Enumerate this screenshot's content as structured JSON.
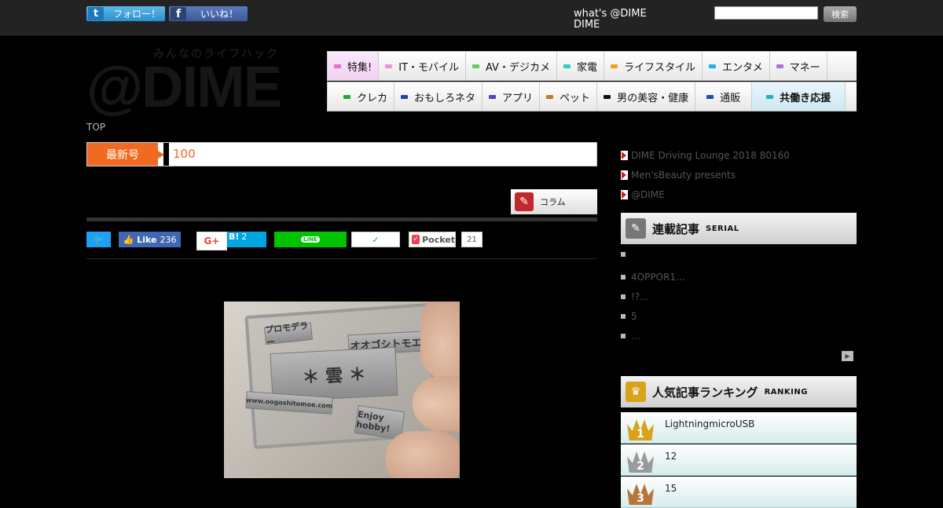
{
  "topbar": {
    "twitter_follow": "フォロー！",
    "twitter_icon": "t",
    "facebook_like": "いいね！",
    "facebook_icon": "f",
    "whats_line1": "what's @DIME",
    "whats_line2": "DIME",
    "search_placeholder": "",
    "search_button": "検索"
  },
  "logo": {
    "tagline": "みんなのライフハック",
    "mark": "@DIME"
  },
  "nav": {
    "row1": [
      {
        "label": "特集!",
        "color": "#e86bd8"
      },
      {
        "label": "IT・モバイル",
        "color": "#f090e0"
      },
      {
        "label": "AV・デジカメ",
        "color": "#5ad05a"
      },
      {
        "label": "家電",
        "color": "#2dcfc2"
      },
      {
        "label": "ライフスタイル",
        "color": "#f0a020"
      },
      {
        "label": "エンタメ",
        "color": "#1fb3e0"
      },
      {
        "label": "マネー",
        "color": "#b070e0"
      }
    ],
    "row2": [
      {
        "label": "クレカ",
        "color": "#1faa2a"
      },
      {
        "label": "おもしろネタ",
        "color": "#1f3faa"
      },
      {
        "label": "アプリ",
        "color": "#5a3fc0"
      },
      {
        "label": "ペット",
        "color": "#c08020"
      },
      {
        "label": "男の美容・健康",
        "color": "#111111"
      },
      {
        "label": "通販",
        "color": "#1f4faa"
      },
      {
        "label": "共働き応援",
        "color": "#1fb3c0"
      }
    ]
  },
  "breadcrumb": "TOP",
  "latest": {
    "tag": "最新号",
    "text": "100"
  },
  "column_tab": "コラム",
  "share": {
    "twitter_icon": "🐦",
    "fb_like": "Like",
    "fb_count": "236",
    "gplus": "G+",
    "hatena_label": "B!",
    "hatena_count": "2",
    "line_label": "LINE",
    "line_count": "✓",
    "pocket_icon": "✓",
    "pocket_label": "Pocket",
    "pocket_count": "21"
  },
  "photo": {
    "plate1": "プロモデラー",
    "plate2": "オオゴシトモエ",
    "plate3": "＊ 雲 ＊",
    "plate4": "Enjoy hobby!",
    "plate5": "www.oogoshitomoe.com"
  },
  "sidebar": {
    "links": [
      "DIME Driving Lounge 2018 80160",
      "Men'sBeauty presents",
      "@DIME"
    ],
    "serial": {
      "title": "連載記事",
      "subtitle": "SERIAL",
      "icon": "✎",
      "items": [
        "",
        "4OPPOR1…",
        "!?…",
        "5",
        "…"
      ],
      "more_icon": "▶"
    },
    "ranking": {
      "title": "人気記事ランキング",
      "subtitle": "RANKING",
      "icon": "♛",
      "items": [
        {
          "rank": "1",
          "text": "LightningmicroUSB"
        },
        {
          "rank": "2",
          "text": "12"
        },
        {
          "rank": "3",
          "text": "15"
        }
      ]
    }
  }
}
